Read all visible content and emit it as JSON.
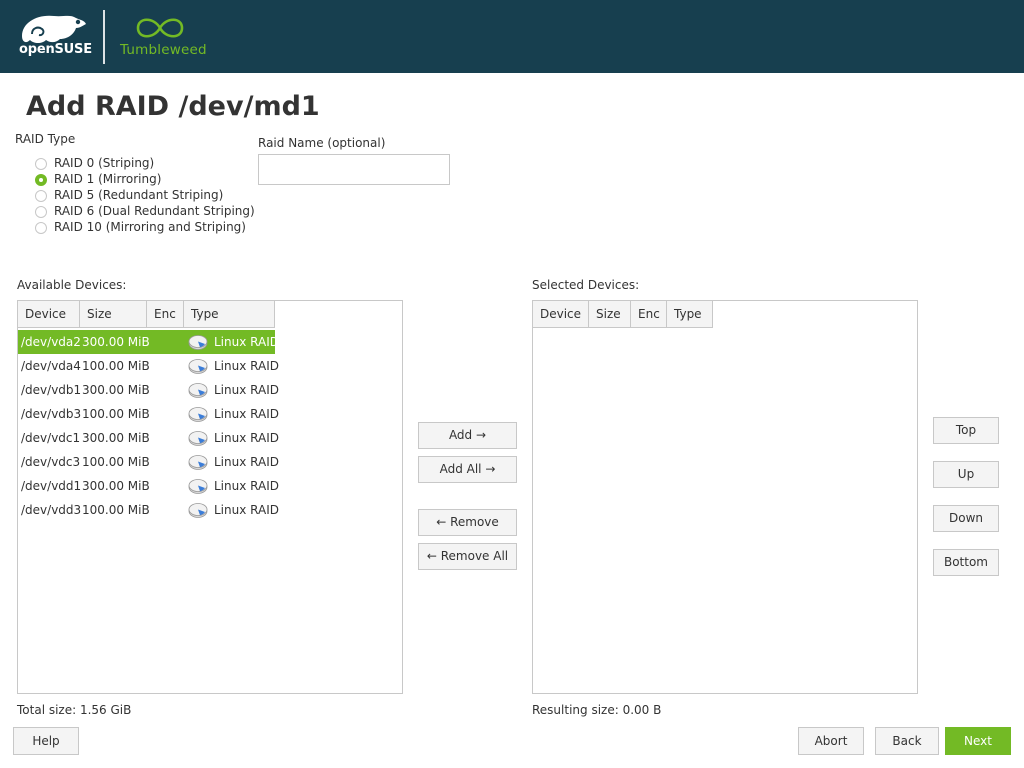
{
  "header": {
    "brand": "openSUSE",
    "product": "Tumbleweed",
    "colors": {
      "bg": "#173f4f",
      "accent": "#73ba25"
    }
  },
  "page_title": "Add RAID /dev/md1",
  "raid_type": {
    "label": "RAID Type",
    "selected": "RAID 1",
    "options": [
      {
        "label": "RAID 0  (Striping)",
        "checked": false
      },
      {
        "label": "RAID 1  (Mirroring)",
        "checked": true
      },
      {
        "label": "RAID 5  (Redundant Striping)",
        "checked": false
      },
      {
        "label": "RAID 6  (Dual Redundant Striping)",
        "checked": false
      },
      {
        "label": "RAID 10  (Mirroring and Striping)",
        "checked": false
      }
    ]
  },
  "raid_name": {
    "label": "Raid Name (optional)",
    "value": ""
  },
  "available": {
    "label": "Available Devices:",
    "columns": [
      "Device",
      "Size",
      "Enc",
      "Type"
    ],
    "rows": [
      {
        "device": "/dev/vda2",
        "size": "300.00 MiB",
        "enc": "",
        "type": "Linux RAID",
        "icon": "disk-icon",
        "selected": true
      },
      {
        "device": "/dev/vda4",
        "size": "100.00 MiB",
        "enc": "",
        "type": "Linux RAID",
        "icon": "disk-icon",
        "selected": false
      },
      {
        "device": "/dev/vdb1",
        "size": "300.00 MiB",
        "enc": "",
        "type": "Linux RAID",
        "icon": "disk-icon",
        "selected": false
      },
      {
        "device": "/dev/vdb3",
        "size": "100.00 MiB",
        "enc": "",
        "type": "Linux RAID",
        "icon": "disk-icon",
        "selected": false
      },
      {
        "device": "/dev/vdc1",
        "size": "300.00 MiB",
        "enc": "",
        "type": "Linux RAID",
        "icon": "disk-icon",
        "selected": false
      },
      {
        "device": "/dev/vdc3",
        "size": "100.00 MiB",
        "enc": "",
        "type": "Linux RAID",
        "icon": "disk-icon",
        "selected": false
      },
      {
        "device": "/dev/vdd1",
        "size": "300.00 MiB",
        "enc": "",
        "type": "Linux RAID",
        "icon": "disk-icon",
        "selected": false
      },
      {
        "device": "/dev/vdd3",
        "size": "100.00 MiB",
        "enc": "",
        "type": "Linux RAID",
        "icon": "disk-icon",
        "selected": false
      }
    ],
    "total_size": "Total size: 1.56 GiB"
  },
  "selected": {
    "label": "Selected Devices:",
    "columns": [
      "Device",
      "Size",
      "Enc",
      "Type"
    ],
    "rows": [],
    "resulting_size": "Resulting size: 0.00 B"
  },
  "transfer_buttons": {
    "add": "Add →",
    "add_all": "Add All →",
    "remove": "← Remove",
    "remove_all": "← Remove All"
  },
  "order_buttons": {
    "top": "Top",
    "up": "Up",
    "down": "Down",
    "bottom": "Bottom"
  },
  "footer": {
    "help": "Help",
    "abort": "Abort",
    "back": "Back",
    "next": "Next"
  }
}
